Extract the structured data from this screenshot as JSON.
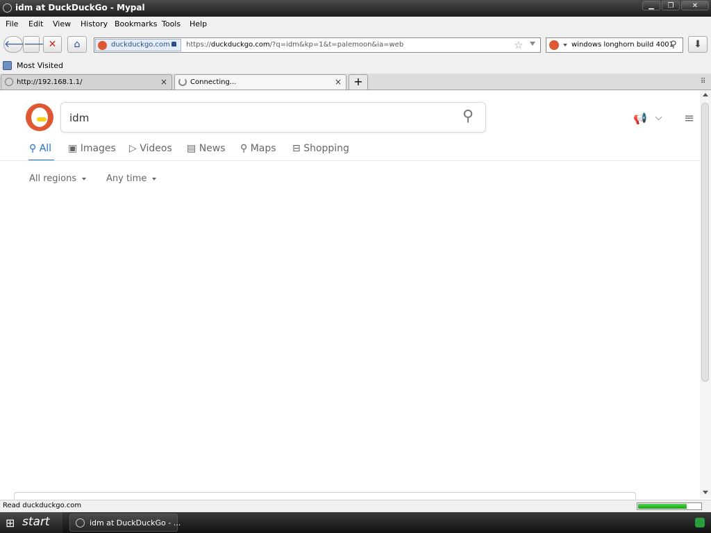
{
  "window": {
    "title": "idm at DuckDuckGo - Mypal",
    "controls": [
      "minimize",
      "maximize",
      "close"
    ]
  },
  "menubar": {
    "items": [
      "File",
      "Edit",
      "View",
      "History",
      "Bookmarks",
      "Tools",
      "Help"
    ]
  },
  "navbar": {
    "identity_site": "duckduckgo.com",
    "url_prefix": "https://",
    "url_host": "duckduckgo.com",
    "url_path": "/?q=idm&kp=1&t=palemoon&ia=web",
    "search_value": "windows longhorn build 4001"
  },
  "bookmarks": {
    "items": [
      {
        "label": "Most Visited",
        "icon": "folder-icon"
      }
    ]
  },
  "tabs": [
    {
      "label": "http://192.168.1.1/",
      "active": false
    },
    {
      "label": "Connecting...",
      "active": true
    }
  ],
  "page": {
    "query": "idm",
    "search_tabs": [
      "All",
      "Images",
      "Videos",
      "News",
      "Maps",
      "Shopping"
    ],
    "active_tab": "All",
    "filters": {
      "region": "All regions",
      "time": "Any time"
    }
  },
  "status": {
    "text": "Read duckduckgo.com",
    "progress_fraction": 0.78
  },
  "taskbar": {
    "start_label": "start",
    "task_label": "idm at DuckDuckGo - ..."
  },
  "colors": {
    "accent": "#1a6fd4",
    "ddg_orange": "#de5833",
    "progress_green": "#16a616"
  }
}
